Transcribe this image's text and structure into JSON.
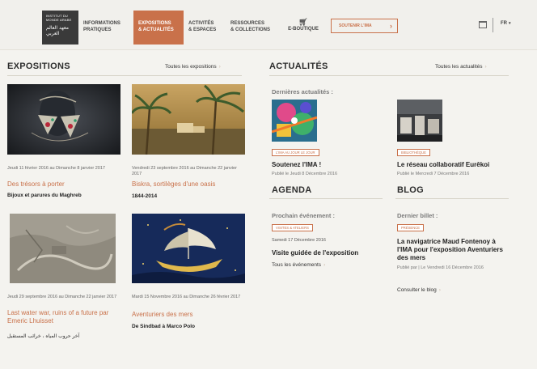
{
  "header": {
    "logo_text": "INSTITUT DU MONDE ARABE",
    "logo_arabic": "معهد العالم العربي",
    "nav": [
      {
        "line1": "Informations",
        "line2": "pratiques"
      },
      {
        "line1": "Expositions",
        "line2": "& actualités",
        "active": true
      },
      {
        "line1": "Activités",
        "line2": "& espaces"
      },
      {
        "line1": "Ressources",
        "line2": "& collections"
      },
      {
        "line1": "E-boutique"
      }
    ],
    "support_label": "Soutenir l'IMA",
    "lang": "FR",
    "accent_color": "#c9714a"
  },
  "expositions": {
    "title": "Expositions",
    "all_link": "Toutes les expositions",
    "items": [
      {
        "date": "Jeudi 11 février 2016 au Dimanche 8 janvier 2017",
        "title": "Des trésors à porter",
        "subtitle": "Bijoux et parures du Maghreb"
      },
      {
        "date": "Vendredi 23 septembre 2016 au Dimanche 22 janvier 2017",
        "title": "Biskra, sortilèges d'une oasis",
        "subtitle": "1844-2014"
      },
      {
        "date": "Jeudi 29 septembre 2016 au Dimanche 22 janvier 2017",
        "title": "Last water war, ruins of a future par Emeric Lhuisset",
        "subtitle": "آخر حروب المياه ، خرائب المستقبل"
      },
      {
        "date": "Mardi 15 Novembre 2016 au Dimanche 26 février 2017",
        "title": "Aventuriers des mers",
        "subtitle": "De Sindbad à Marco Polo"
      }
    ]
  },
  "actualites": {
    "title": "Actualités",
    "all_link": "Toutes les actualités",
    "subhead": "Dernières actualités :",
    "items": [
      {
        "tag": "L'IMA au jour le jour",
        "title": "Soutenez l'IMA !",
        "meta": "Publié le Jeudi 8 Décembre 2016"
      },
      {
        "tag": "Bibliothèque",
        "title": "Le réseau collaboratif Eurêkoi",
        "meta": "Publié le Mercredi 7 Décembre 2016"
      }
    ]
  },
  "agenda": {
    "title": "Agenda",
    "subhead": "Prochain événement :",
    "tag": "Visites & ateliers",
    "date": "Samedi 17 Décembre 2016",
    "event_title": "Visite guidée de l'exposition",
    "all_link": "Tous les événements"
  },
  "blog": {
    "title": "Blog",
    "subhead": "Dernier billet :",
    "tag": "Présence",
    "post_title": "La navigatrice Maud Fontenoy à l'IMA pour l'exposition Aventuriers des mers",
    "meta": "Publié par | Le Vendredi 16 Décembre 2016",
    "link": "Consulter le blog"
  }
}
